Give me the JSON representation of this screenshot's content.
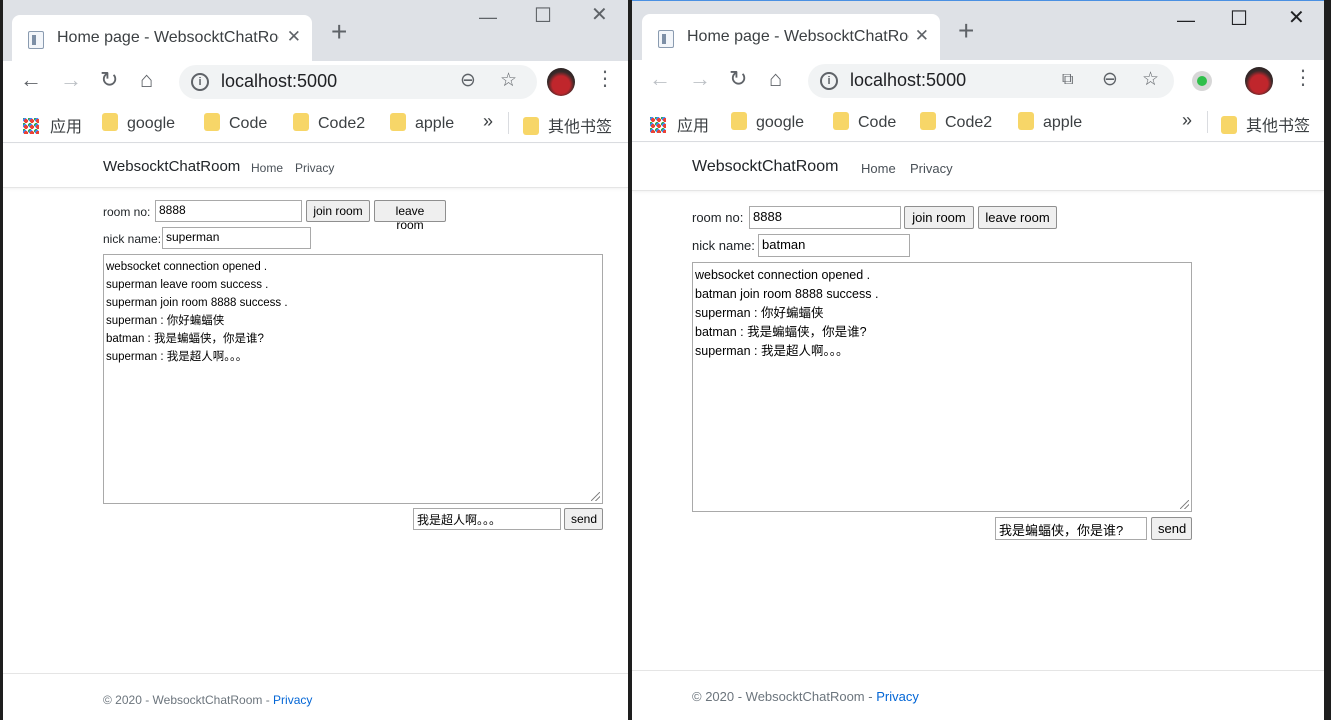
{
  "browser": {
    "tab_title": "Home page - WebsocktChatRoom",
    "address": "localhost:5000",
    "bookmarks": [
      "应用",
      "google",
      "Code",
      "Code2",
      "apple"
    ],
    "bookmarks_more": "»",
    "bookmarks_other": "其他书签"
  },
  "site": {
    "brand": "WebsocktChatRoom",
    "nav": [
      "Home",
      "Privacy"
    ],
    "labels": {
      "room_no": "room no:",
      "nick_name": "nick name:",
      "join": "join room",
      "leave": "leave room",
      "send": "send"
    },
    "footer": {
      "text": "© 2020 - WebsocktChatRoom - ",
      "link": "Privacy"
    }
  },
  "left_window": {
    "room_no": "8888",
    "nick_name": "superman",
    "messages": [
      "websocket connection opened .",
      "superman leave room  success .",
      "superman join room 8888 success .",
      "superman : 你好蝙蝠侠",
      "batman : 我是蝙蝠侠，你是谁?",
      "superman : 我是超人啊。。。"
    ],
    "message_input": "我是超人啊。。。"
  },
  "right_window": {
    "room_no": "8888",
    "nick_name": "batman",
    "messages": [
      "websocket connection opened .",
      "batman join room 8888 success .",
      "superman : 你好蝙蝠侠",
      "batman : 我是蝙蝠侠，你是谁?",
      "superman : 我是超人啊。。。"
    ],
    "message_input": "我是蝙蝠侠，你是谁?"
  }
}
